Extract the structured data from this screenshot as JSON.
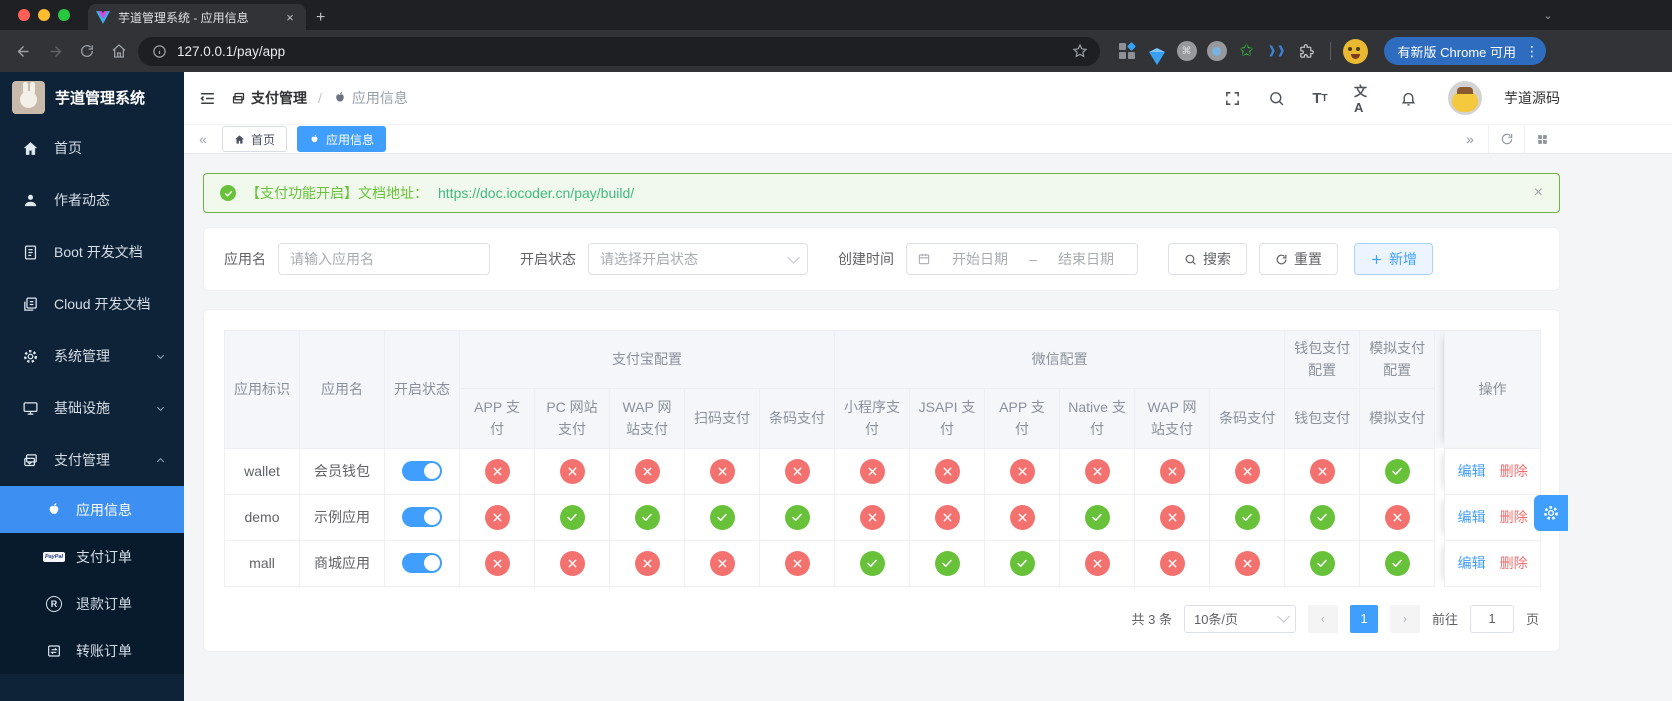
{
  "browser": {
    "tab_title": "芋道管理系统 - 应用信息",
    "tab_close": "×",
    "new_tab": "+",
    "url": "127.0.0.1/pay/app",
    "update_button_label": "有新版 Chrome 可用",
    "kebab": "⋮",
    "strip_chevron": "⌄"
  },
  "sidebar": {
    "title": "芋道管理系统",
    "items": [
      {
        "label": "首页"
      },
      {
        "label": "作者动态"
      },
      {
        "label": "Boot 开发文档"
      },
      {
        "label": "Cloud 开发文档"
      },
      {
        "label": "系统管理"
      },
      {
        "label": "基础设施"
      },
      {
        "label": "支付管理"
      }
    ],
    "subitems": [
      {
        "label": "应用信息"
      },
      {
        "label": "支付订单"
      },
      {
        "label": "退款订单"
      },
      {
        "label": "转账订单"
      }
    ]
  },
  "header": {
    "breadcrumb": {
      "section": "支付管理",
      "separator": "/",
      "page": "应用信息"
    },
    "username": "芋道源码"
  },
  "tags": {
    "collapse": "«",
    "expand": "»",
    "tabs": [
      {
        "label": "首页"
      },
      {
        "label": "应用信息"
      }
    ]
  },
  "alert": {
    "text": "【支付功能开启】文档地址：",
    "link": "https://doc.iocoder.cn/pay/build/",
    "close": "×"
  },
  "filters": {
    "app_name_label": "应用名",
    "app_name_placeholder": "请输入应用名",
    "status_label": "开启状态",
    "status_placeholder": "请选择开启状态",
    "date_label": "创建时间",
    "date_start_placeholder": "开始日期",
    "date_separator": "–",
    "date_end_placeholder": "结束日期",
    "search_button": "搜索",
    "reset_button": "重置",
    "add_button": "新增"
  },
  "table": {
    "fixed_headers": [
      "应用标识",
      "应用名",
      "开启状态"
    ],
    "groups": [
      {
        "label": "支付宝配置",
        "cols": [
          "APP 支付",
          "PC 网站支付",
          "WAP 网站支付",
          "扫码支付",
          "条码支付"
        ]
      },
      {
        "label": "微信配置",
        "cols": [
          "小程序支付",
          "JSAPI 支付",
          "APP 支付",
          "Native 支付",
          "WAP 网站支付",
          "条码支付"
        ]
      },
      {
        "label": "钱包支付配置",
        "cols": [
          "钱包支付"
        ]
      },
      {
        "label": "模拟支付配置",
        "cols": [
          "模拟支付"
        ]
      }
    ],
    "action_header": "操作",
    "edit_label": "编辑",
    "delete_label": "删除",
    "rows": [
      {
        "id": "wallet",
        "name": "会员钱包",
        "enabled": true,
        "statuses": [
          false,
          false,
          false,
          false,
          false,
          false,
          false,
          false,
          false,
          false,
          false,
          false,
          true
        ]
      },
      {
        "id": "demo",
        "name": "示例应用",
        "enabled": true,
        "statuses": [
          false,
          true,
          true,
          true,
          true,
          false,
          false,
          false,
          true,
          false,
          true,
          true,
          false
        ]
      },
      {
        "id": "mall",
        "name": "商城应用",
        "enabled": true,
        "statuses": [
          false,
          false,
          false,
          false,
          false,
          true,
          true,
          true,
          false,
          false,
          false,
          true,
          true
        ]
      }
    ]
  },
  "pagination": {
    "total": "共 3 条",
    "page_size": "10条/页",
    "prev": "‹",
    "current_page": "1",
    "next": "›",
    "goto_label": "前往",
    "goto_value": "1",
    "page_label": "页"
  },
  "colors": {
    "primary": "#409eff",
    "success": "#67c23a",
    "danger": "#f56c6c",
    "sidebar_bg": "#0e2338",
    "alert_bg": "#f0f9eb"
  }
}
